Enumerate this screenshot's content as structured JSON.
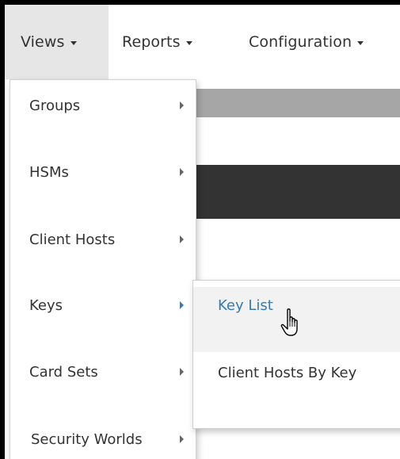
{
  "nav": {
    "items": [
      {
        "label": "Views"
      },
      {
        "label": "Reports"
      },
      {
        "label": "Configuration"
      }
    ]
  },
  "views_menu": {
    "items": [
      {
        "label": "Groups"
      },
      {
        "label": "HSMs"
      },
      {
        "label": "Client Hosts"
      },
      {
        "label": "Keys"
      },
      {
        "label": "Card Sets"
      },
      {
        "label": "Security Worlds"
      }
    ]
  },
  "keys_submenu": {
    "items": [
      {
        "label": "Key List"
      },
      {
        "label": "Client Hosts By Key"
      }
    ]
  },
  "colors": {
    "link_blue": "#337ab7",
    "text": "#333333",
    "active_nav_bg": "#e6e6e6"
  },
  "icons": {
    "cursor": "hand-pointer-icon"
  }
}
